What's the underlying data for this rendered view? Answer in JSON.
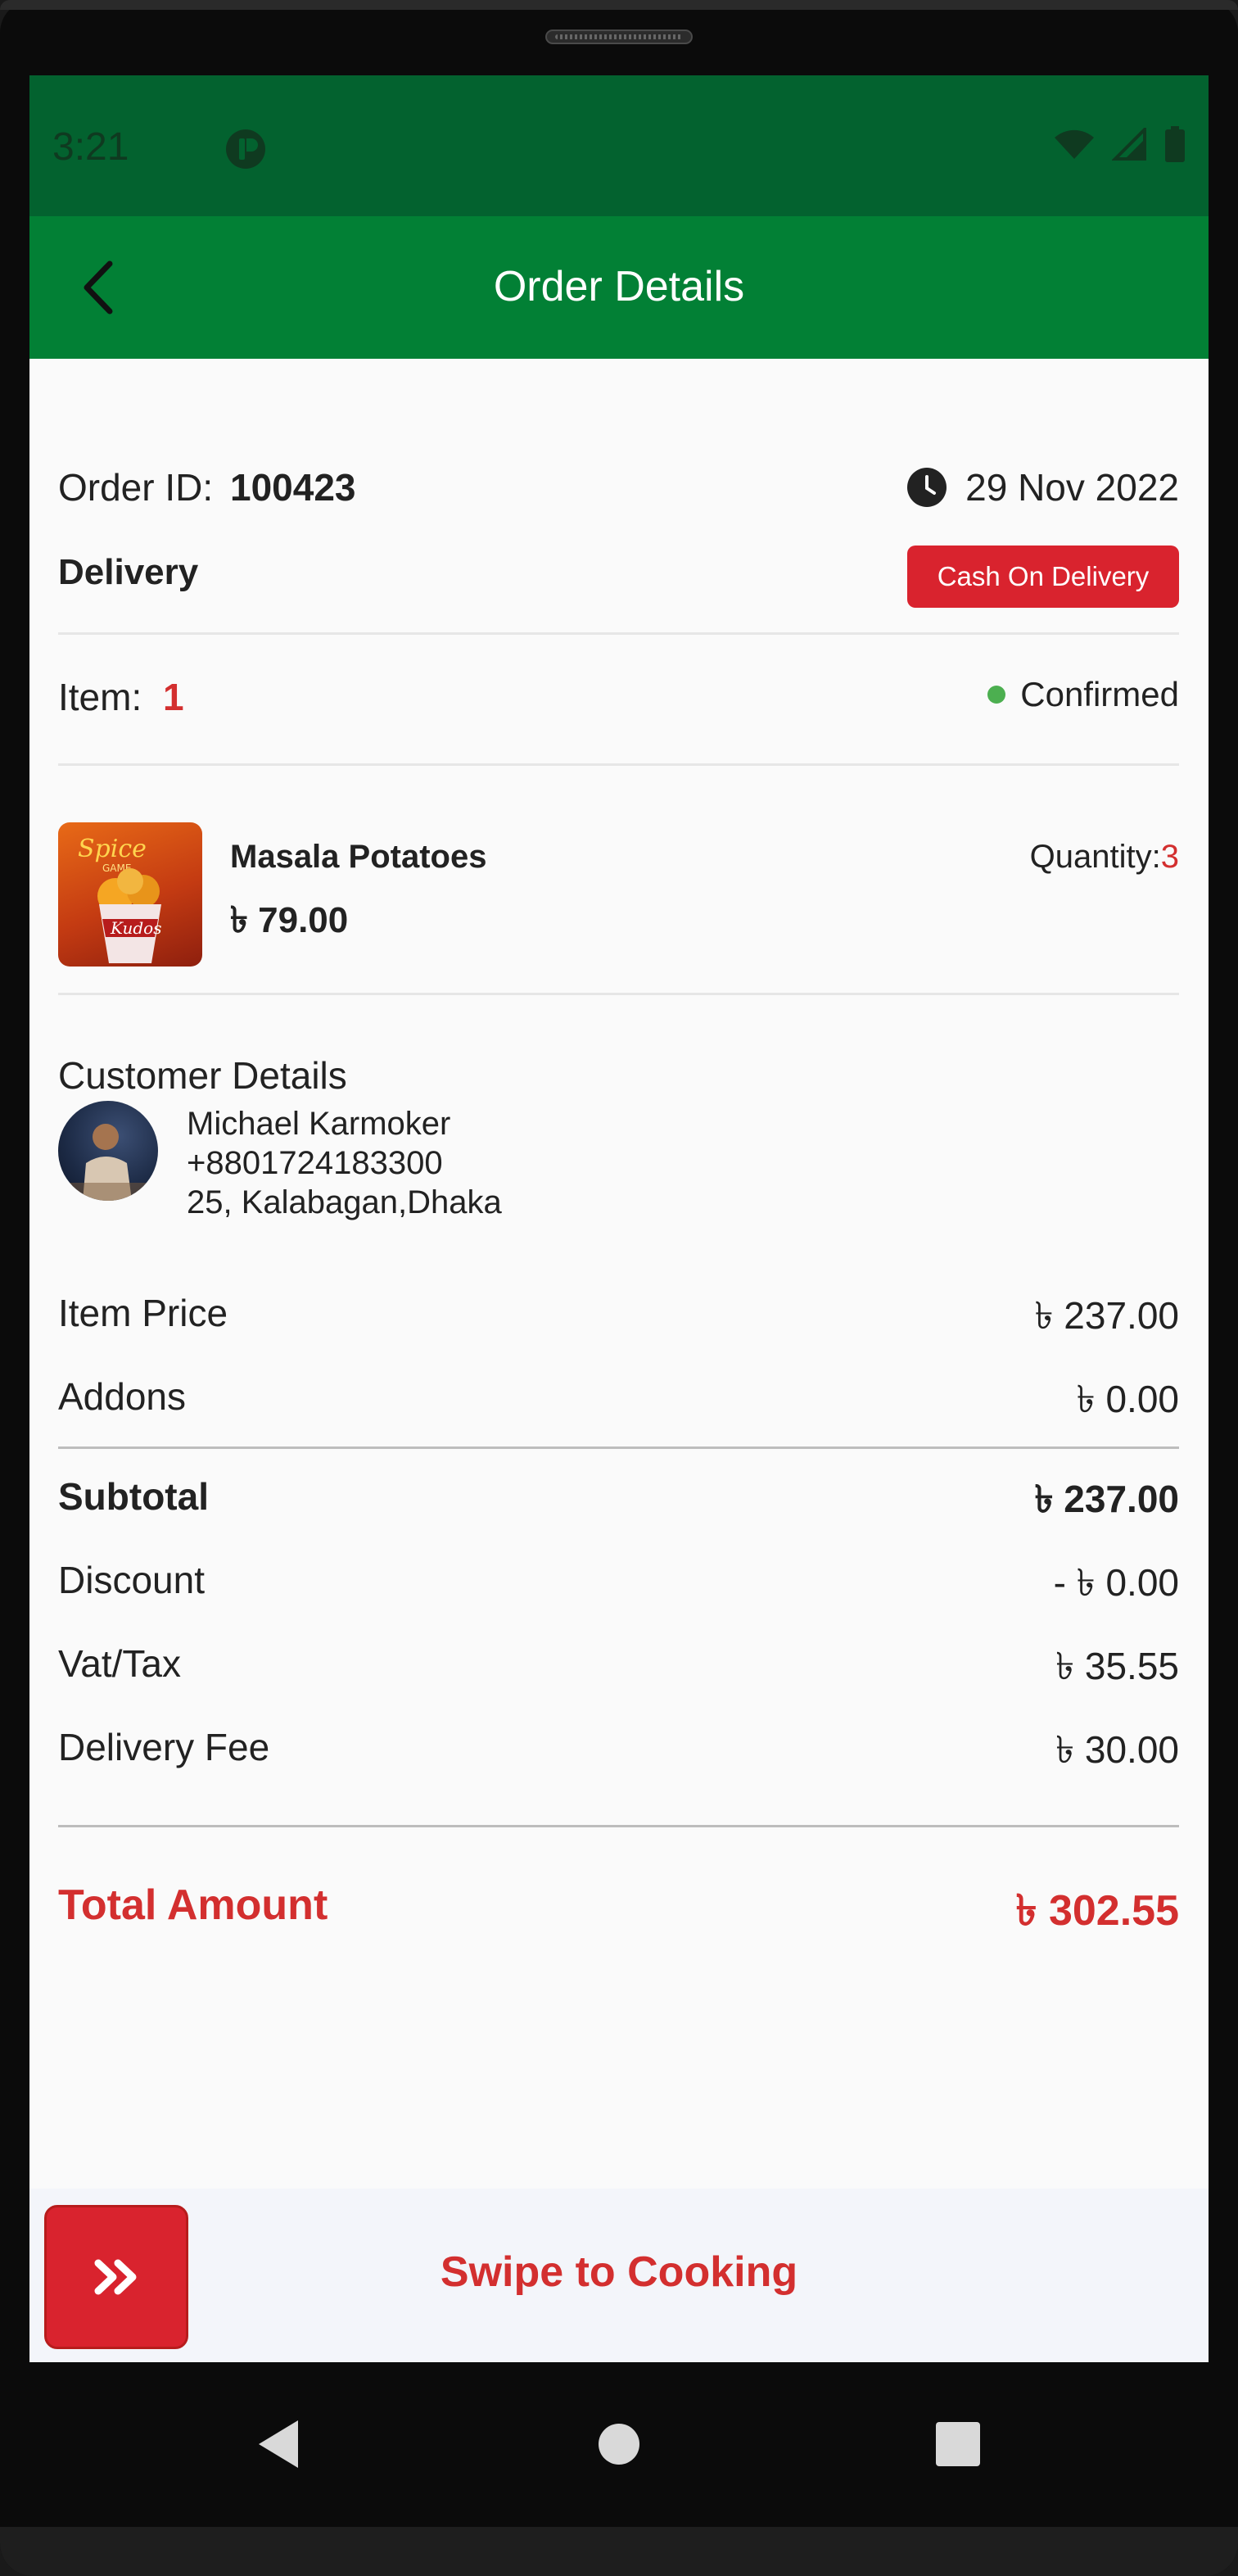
{
  "status_bar": {
    "time": "3:21"
  },
  "header": {
    "title": "Order Details"
  },
  "order": {
    "id_label": "Order ID:",
    "id_value": "100423",
    "date": "29 Nov 2022",
    "type": "Delivery",
    "payment_method": "Cash On Delivery",
    "item_label": "Item:",
    "item_count": "1",
    "status": "Confirmed"
  },
  "items": [
    {
      "name": "Masala Potatoes",
      "price": "৳ 79.00",
      "quantity_label": "Quantity:",
      "quantity": "3",
      "image": "spice-game-fries-thumbnail"
    }
  ],
  "customer": {
    "heading": "Customer Details",
    "name": "Michael Karmoker",
    "phone": "+8801724183300",
    "address": "25, Kalabagan,Dhaka"
  },
  "pricing": {
    "item_price_label": "Item Price",
    "item_price": "৳ 237.00",
    "addons_label": "Addons",
    "addons": "৳ 0.00",
    "subtotal_label": "Subtotal",
    "subtotal": "৳ 237.00",
    "discount_label": "Discount",
    "discount": "- ৳ 0.00",
    "vat_label": "Vat/Tax",
    "vat": "৳ 35.55",
    "delivery_fee_label": "Delivery Fee",
    "delivery_fee": "৳ 30.00",
    "total_label": "Total Amount",
    "total": "৳ 302.55"
  },
  "swipe": {
    "label": "Swipe to Cooking",
    "icon": "double-chevron-right-icon"
  },
  "colors": {
    "status_bar": "#03622f",
    "app_bar": "#028035",
    "accent_red": "#d32f2f",
    "badge_red": "#d9232e",
    "confirmed_green": "#4caf50"
  }
}
